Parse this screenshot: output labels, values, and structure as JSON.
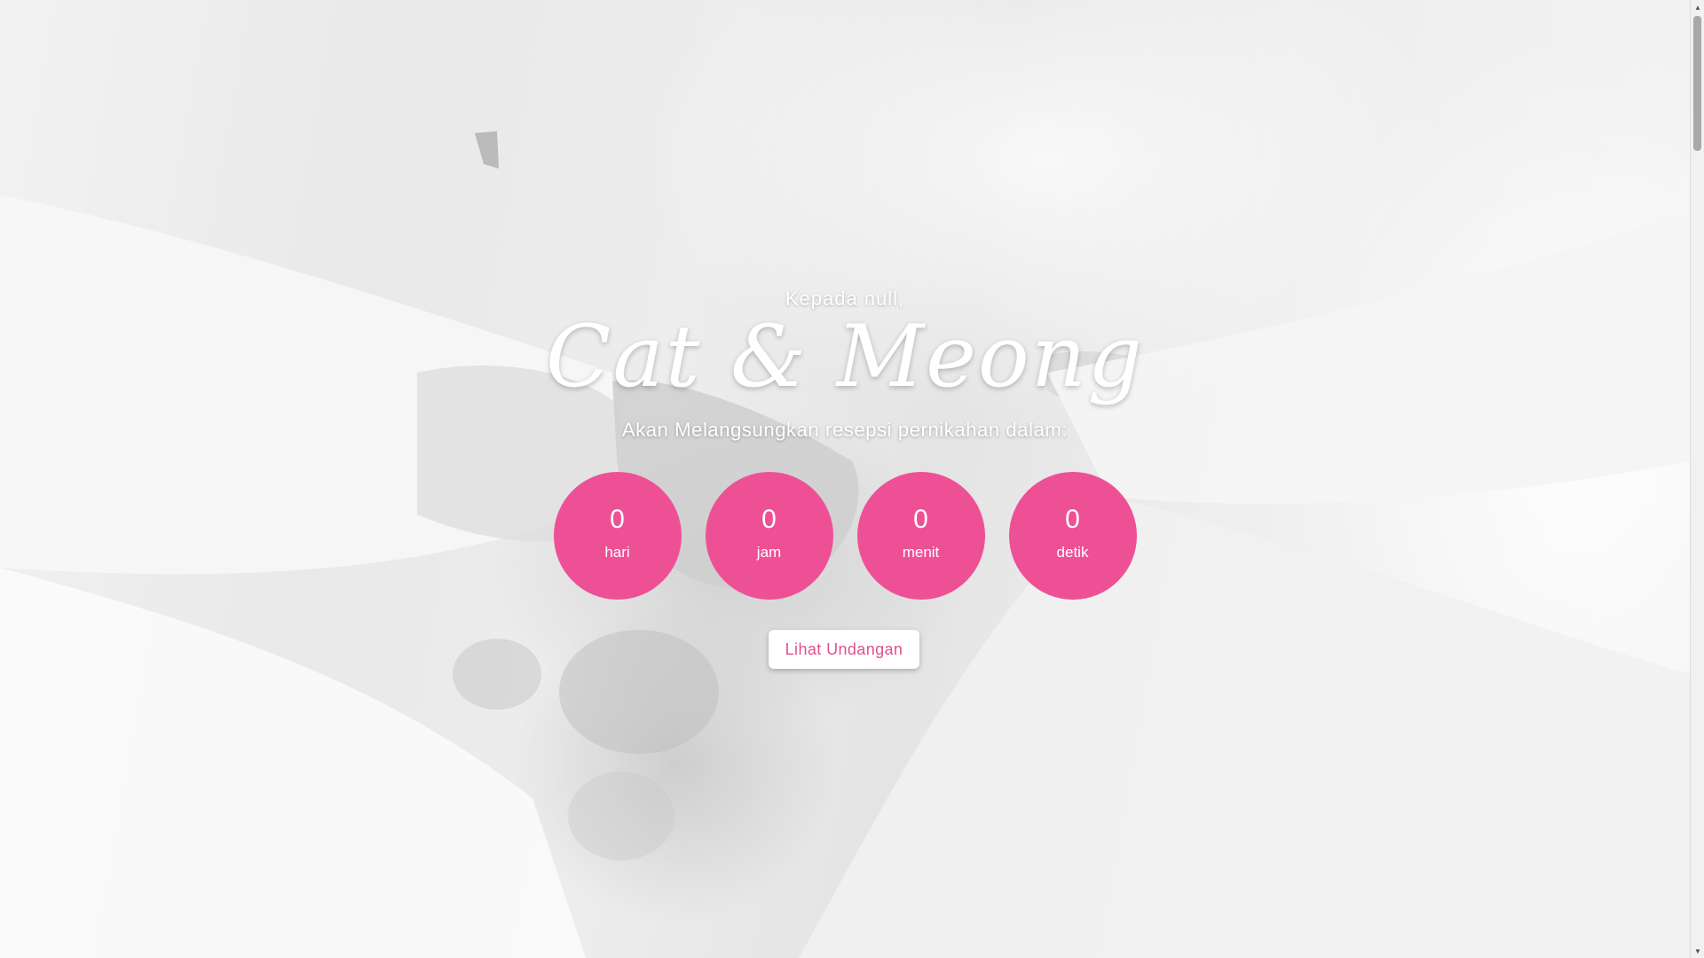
{
  "hero": {
    "greeting": "Kepada null,",
    "couple_names": "Cat & Meong",
    "subtitle": "Akan Melangsungkan resepsi pernikahan dalam:",
    "countdown": [
      {
        "value": "0",
        "label": "hari"
      },
      {
        "value": "0",
        "label": "jam"
      },
      {
        "value": "0",
        "label": "menit"
      },
      {
        "value": "0",
        "label": "detik"
      }
    ],
    "cta_label": "Lihat Undangan"
  },
  "colors": {
    "accent": "#ee5095",
    "cta_text": "#e0508e",
    "text_on_photo": "#ffffff"
  },
  "icons": {
    "scroll_up": "scroll-up-arrow-icon",
    "scroll_down": "scroll-down-arrow-icon"
  }
}
